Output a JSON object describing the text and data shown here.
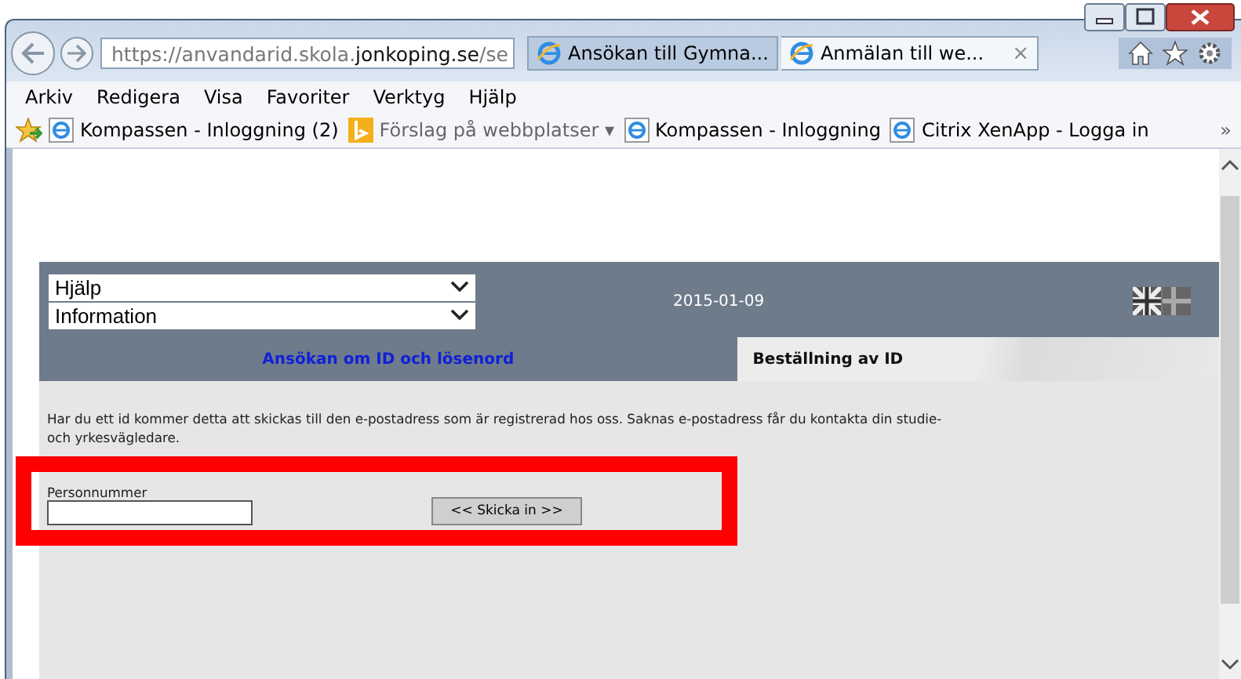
{
  "browser": {
    "address": {
      "parts": [
        {
          "text": "https://anvandarid.skola.",
          "strong": false
        },
        {
          "text": "jonkoping.se",
          "strong": true
        },
        {
          "text": "/se",
          "strong": false
        }
      ]
    },
    "tabs": [
      {
        "label": "Ansökan till Gymna...",
        "selected": false
      },
      {
        "label": "Anmälan till we...",
        "selected": true,
        "close": "×"
      }
    ],
    "menu": [
      "Arkiv",
      "Redigera",
      "Visa",
      "Favoriter",
      "Verktyg",
      "Hjälp"
    ],
    "favorites": [
      {
        "kind": "page",
        "label": "Kompassen - Inloggning (2)"
      },
      {
        "kind": "suggest",
        "label": "Förslag på webbplatser ▾"
      },
      {
        "kind": "page",
        "label": "Kompassen - Inloggning"
      },
      {
        "kind": "page",
        "label": "Citrix XenApp - Logga in"
      }
    ],
    "more": "»"
  },
  "page": {
    "dropdowns": [
      {
        "value": "Hjälp"
      },
      {
        "value": "Information"
      }
    ],
    "date": "2015-01-09",
    "tabs": [
      {
        "label": "Ansökan om ID och lösenord",
        "selected": false
      },
      {
        "label": "Beställning av ID",
        "selected": true
      }
    ],
    "intro": "Har du ett id kommer detta att skickas till den e-postadress som är registrerad hos oss. Saknas e-postadress får du kontakta din studie- och yrkesvägledare.",
    "field_label": "Personnummer",
    "submit": "<< Skicka in >>",
    "highlight": true
  }
}
